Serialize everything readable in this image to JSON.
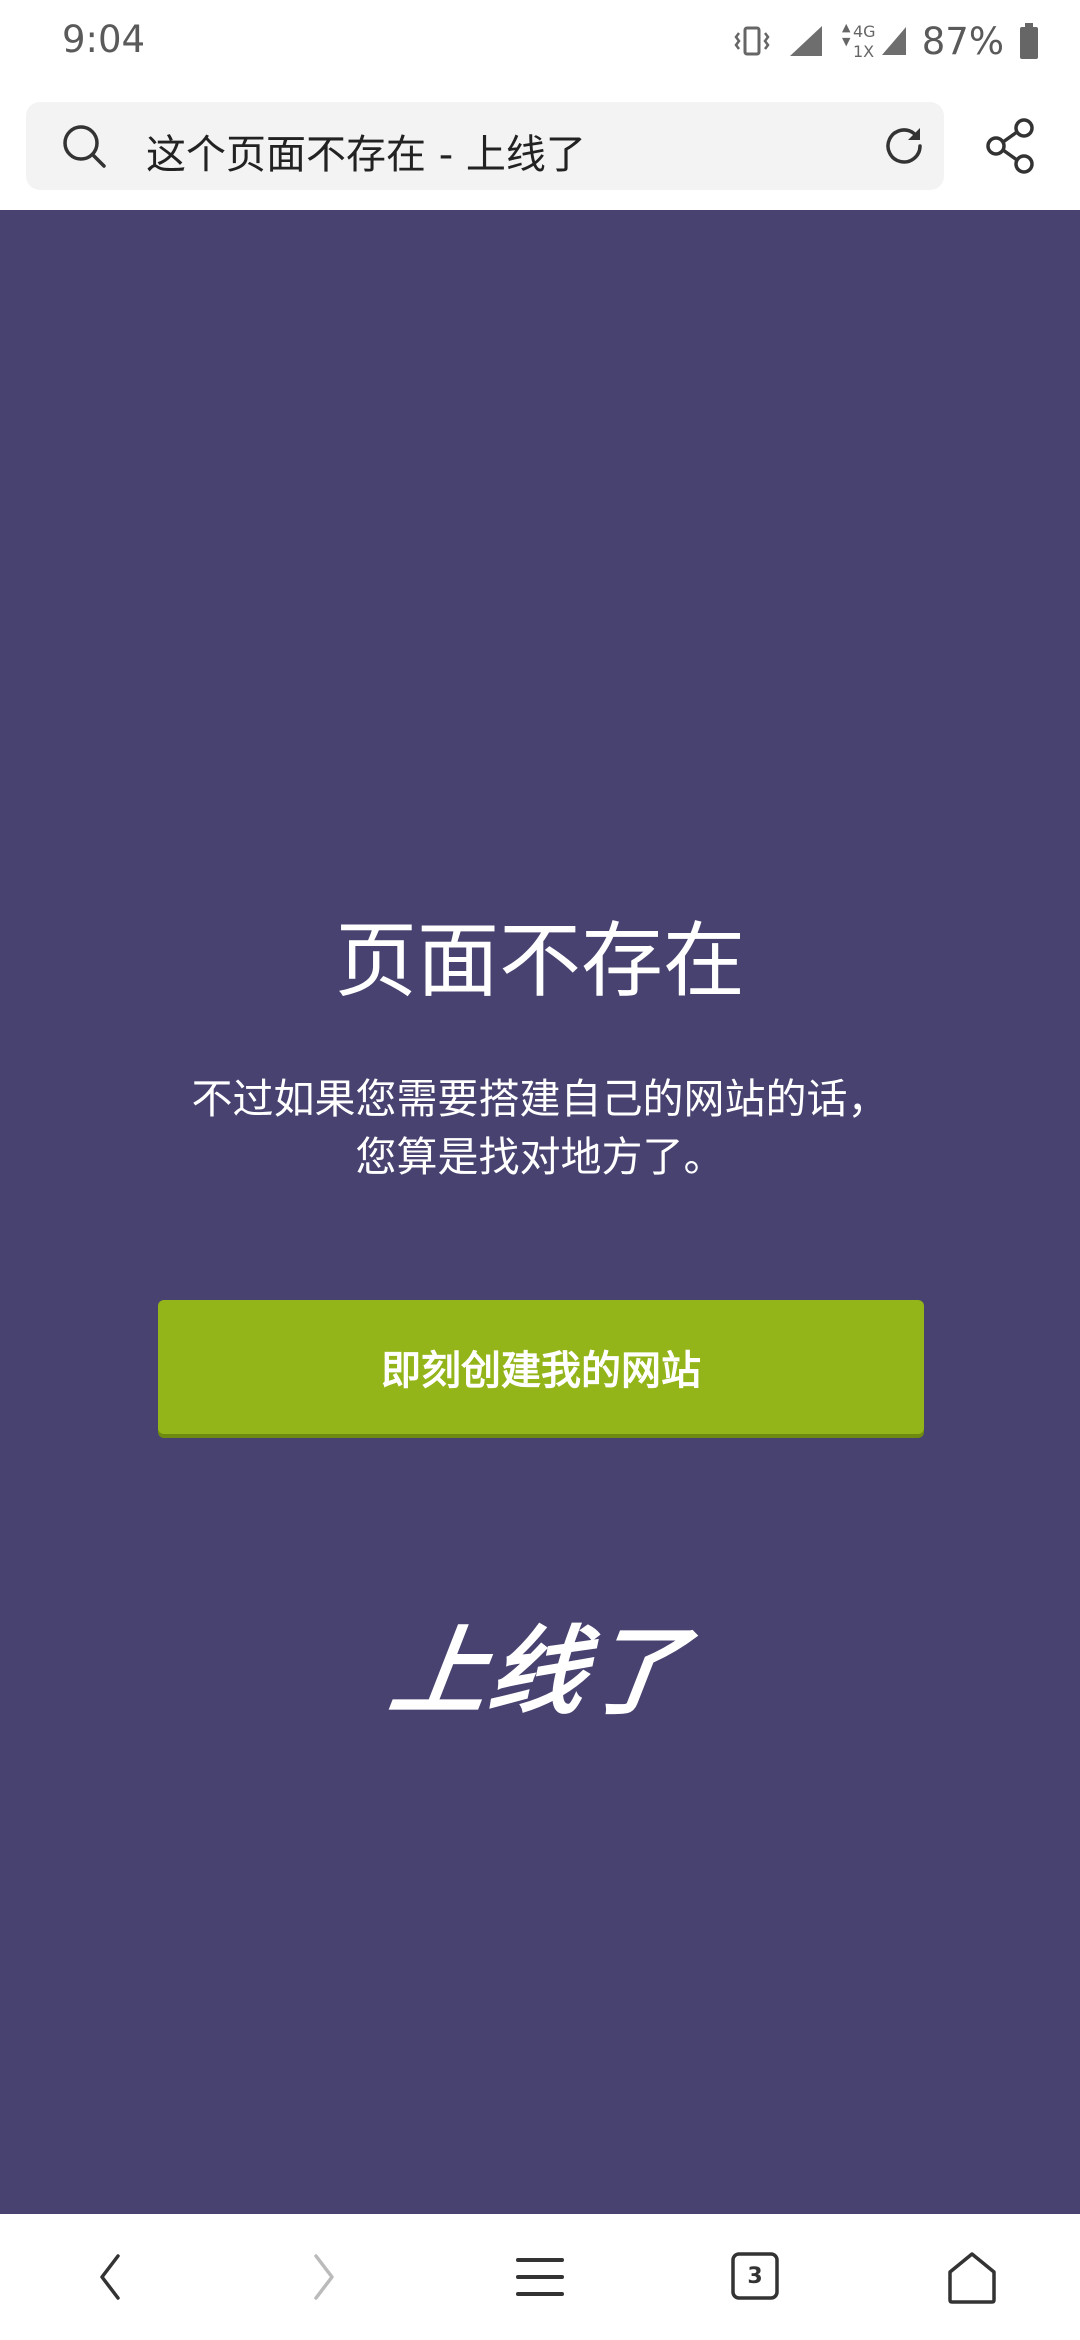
{
  "status_bar": {
    "time": "9:04",
    "network_label_top": "4G",
    "network_label_bottom": "1X",
    "battery_percent": "87%"
  },
  "browser": {
    "url_title": "这个页面不存在 - 上线了",
    "icons": [
      "search-icon",
      "reload-icon",
      "share-icon"
    ]
  },
  "page": {
    "background_color": "#484270",
    "headline": "页面不存在",
    "subtext_line1": "不过如果您需要搭建自己的网站的话，",
    "subtext_line2": "您算是找对地方了。",
    "cta_label": "即刻创建我的网站",
    "cta_color": "#94b51a",
    "brand_logo_text": "上线了"
  },
  "bottom_nav": {
    "tab_count": "3",
    "icons": [
      "back-icon",
      "forward-icon",
      "menu-icon",
      "tabs-icon",
      "home-icon"
    ]
  }
}
